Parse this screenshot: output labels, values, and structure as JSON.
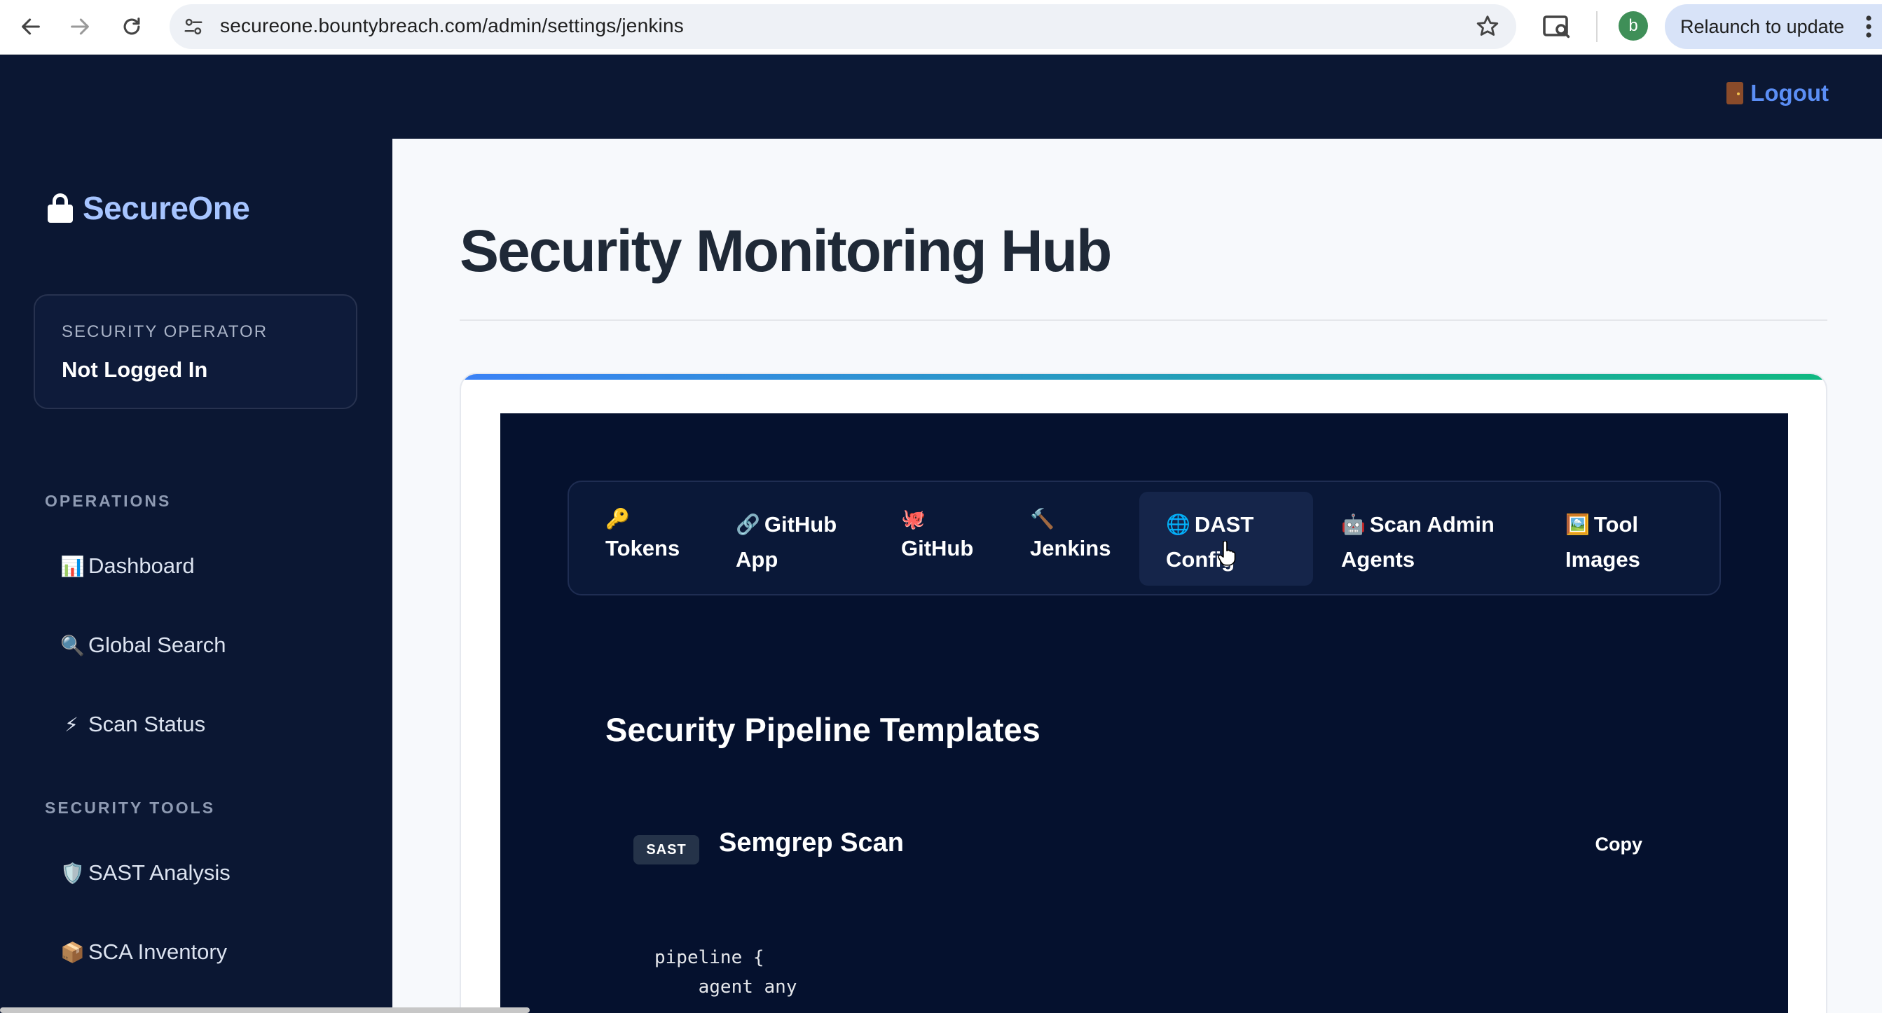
{
  "browser": {
    "url": "secureone.bountybreach.com/admin/settings/jenkins",
    "profile_initial": "b",
    "relaunch_label": "Relaunch to update"
  },
  "header": {
    "logout_label": "Logout"
  },
  "sidebar": {
    "brand": "SecureOne",
    "operator_label": "SECURITY OPERATOR",
    "operator_status": "Not Logged In",
    "sections": [
      {
        "label": "OPERATIONS",
        "items": [
          {
            "icon": "📊",
            "label": "Dashboard"
          },
          {
            "icon": "🔍",
            "label": "Global Search"
          },
          {
            "icon": "⚡",
            "label": "Scan Status"
          }
        ]
      },
      {
        "label": "SECURITY TOOLS",
        "items": [
          {
            "icon": "🛡️",
            "label": "SAST Analysis"
          },
          {
            "icon": "📦",
            "label": "SCA Inventory"
          }
        ]
      }
    ]
  },
  "main": {
    "title": "Security Monitoring Hub",
    "tabs": [
      {
        "icon": "🔑",
        "line1": "",
        "line2": "Tokens"
      },
      {
        "icon": "🔗",
        "line1": "GitHub",
        "line2": "App"
      },
      {
        "icon": "🐙",
        "line1": "",
        "line2": "GitHub"
      },
      {
        "icon": "🔨",
        "line1": "",
        "line2": "Jenkins"
      },
      {
        "icon": "🌐",
        "line1": "DAST",
        "line2": "Config"
      },
      {
        "icon": "🤖",
        "line1": "Scan Admin",
        "line2": "Agents"
      },
      {
        "icon": "🖼️",
        "line1": "Tool",
        "line2": "Images"
      }
    ],
    "section_title": "Security Pipeline Templates",
    "template": {
      "badge": "SAST",
      "name": "Semgrep Scan",
      "copy_label": "Copy",
      "code": "pipeline {\n    agent any"
    }
  },
  "colors": {
    "sidebar_bg": "#0b1733",
    "panel_bg": "#05112e",
    "brand_accent": "#a6c4ff",
    "logout": "#5b8ef5"
  }
}
